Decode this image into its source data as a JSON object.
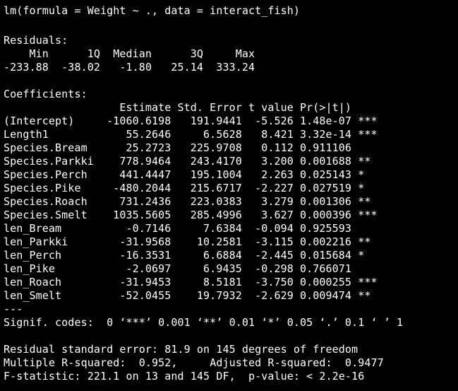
{
  "console": {
    "background": "#000000",
    "foreground": "#ffffff",
    "lines": [
      "lm(formula = Weight ~ ., data = interact_fish)",
      "",
      "Residuals:",
      "    Min      1Q  Median      3Q     Max ",
      "-233.88  -38.02   -1.80   25.14  333.24 ",
      "",
      "Coefficients:",
      "                  Estimate Std. Error t value Pr(>|t|)    ",
      "(Intercept)     -1060.6198   191.9441  -5.526 1.48e-07 ***",
      "Length1            55.2646     6.5628   8.421 3.32e-14 ***",
      "Species.Bream      25.2723   225.9708   0.112 0.911106    ",
      "Species.Parkki    778.9464   243.4170   3.200 0.001688 ** ",
      "Species.Perch     441.4447   195.1004   2.263 0.025143 *  ",
      "Species.Pike     -480.2044   215.6717  -2.227 0.027519 *  ",
      "Species.Roach     731.2436   223.0383   3.279 0.001306 ** ",
      "Species.Smelt    1035.5605   285.4996   3.627 0.000396 ***",
      "len_Bream          -0.7146     7.6384  -0.094 0.925593    ",
      "len_Parkki        -31.9568    10.2581  -3.115 0.002216 ** ",
      "len_Perch         -16.3531     6.6884  -2.445 0.015684 *  ",
      "len_Pike           -2.0697     6.9435  -0.298 0.766071    ",
      "len_Roach         -31.9453     8.5181  -3.750 0.000255 ***",
      "len_Smelt         -52.0455    19.7932  -2.629 0.009474 ** ",
      "---",
      "Signif. codes:  0 ‘***’ 0.001 ‘**’ 0.01 ‘*’ 0.05 ‘.’ 0.1 ‘ ’ 1",
      "",
      "Residual standard error: 81.9 on 145 degrees of freedom",
      "Multiple R-squared:  0.952,\tAdjusted R-squared:  0.9477 ",
      "F-statistic: 221.1 on 13 and 145 DF,  p-value: < 2.2e-16"
    ]
  }
}
